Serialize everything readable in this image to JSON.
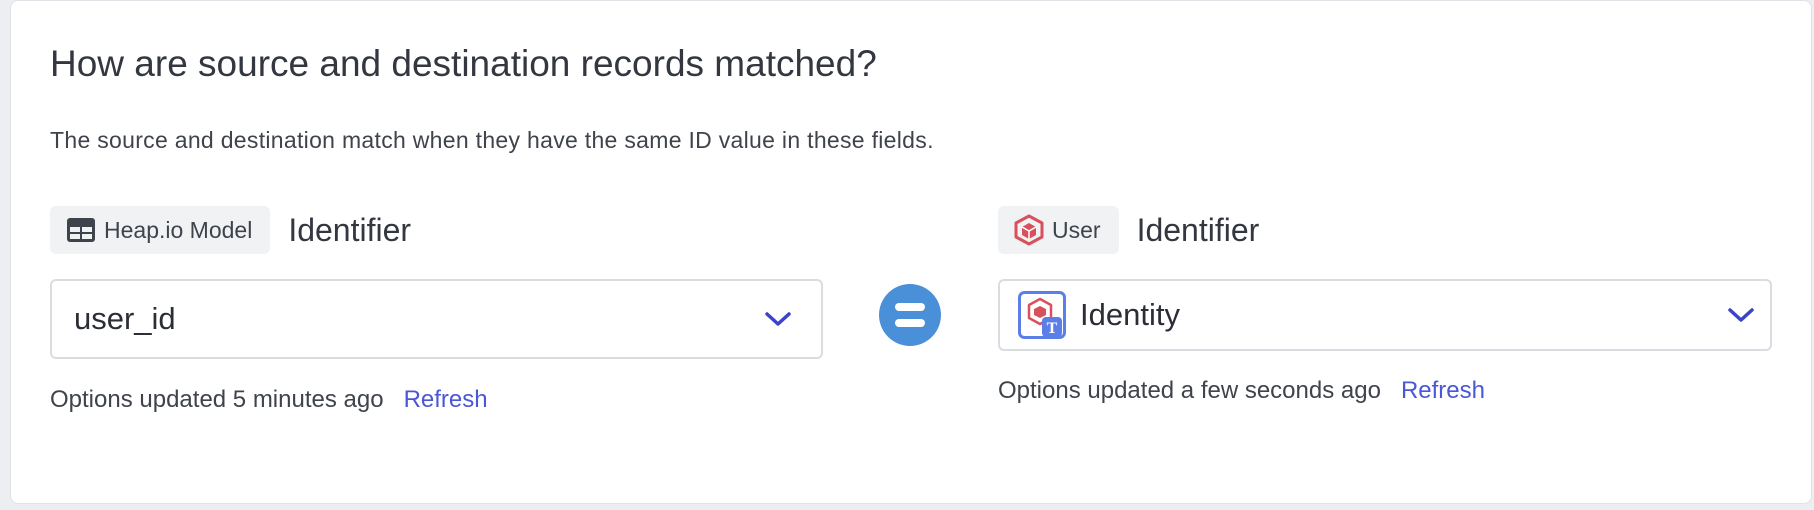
{
  "heading": "How are source and destination records matched?",
  "description": "The source and destination match when they have the same ID value in these fields.",
  "source": {
    "chip_icon": "table-icon",
    "chip_label": "Heap.io Model",
    "field_title": "Identifier",
    "selected_value": "user_id",
    "options_status": "Options updated 5 minutes ago",
    "refresh_label": "Refresh"
  },
  "match_icon": "equals-icon",
  "destination": {
    "chip_icon": "cube-icon",
    "chip_label": "User",
    "field_title": "Identifier",
    "value_icon": "identity-text-field-icon",
    "selected_value": "Identity",
    "options_status": "Options updated a few seconds ago",
    "refresh_label": "Refresh"
  },
  "colors": {
    "accent": "#4a57d6",
    "equals_badge": "#4a90d9",
    "cube_red": "#d8505c",
    "text_field_badge": "#5b7fe6"
  }
}
